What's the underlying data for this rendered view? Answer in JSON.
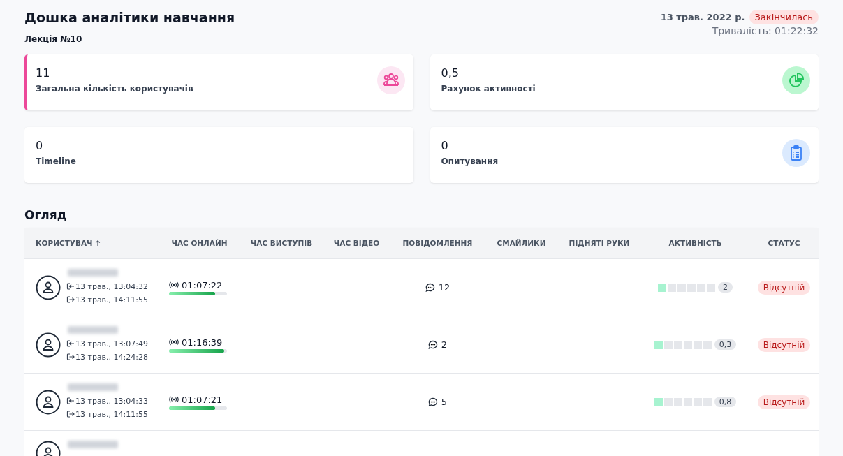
{
  "header": {
    "title": "Дошка аналітики навчання",
    "subtitle": "Лекція №10",
    "date": "13 трав. 2022 р.",
    "status": "Закінчилась",
    "duration": "Тривалість: 01:22:32"
  },
  "cards": [
    {
      "value": "11",
      "label": "Загальна кількість користувачів",
      "kind": "users",
      "accent": true
    },
    {
      "value": "0,5",
      "label": "Рахунок активності",
      "kind": "pie",
      "accent": false
    },
    {
      "value": "0",
      "label": "Timeline",
      "kind": "plain",
      "accent": false
    },
    {
      "value": "0",
      "label": "Опитування",
      "kind": "clipboard",
      "accent": false
    }
  ],
  "overview": {
    "title": "Огляд",
    "columns": [
      {
        "label": "КОРИСТУВАЧ",
        "sorted": true
      },
      {
        "label": "ЧАС ОНЛАЙН",
        "sorted": false
      },
      {
        "label": "ЧАС ВИСТУПІВ",
        "sorted": false
      },
      {
        "label": "ЧАС ВІДЕО",
        "sorted": false
      },
      {
        "label": "ПОВІДОМЛЕННЯ",
        "sorted": false
      },
      {
        "label": "СМАЙЛИКИ",
        "sorted": false
      },
      {
        "label": "ПІДНЯТІ РУКИ",
        "sorted": false
      },
      {
        "label": "АКТИВНІСТЬ",
        "sorted": false
      },
      {
        "label": "СТАТУС",
        "sorted": false
      }
    ],
    "rows": [
      {
        "cut": false,
        "joined": "13 трав., 13:04:32",
        "left": "13 трав., 14:11:55",
        "online": "01:07:22",
        "level": 0.8,
        "messages": "12",
        "stars": 1,
        "activity": "2",
        "status": "Відсутній"
      },
      {
        "cut": false,
        "joined": "13 трав., 13:07:49",
        "left": "13 трав., 14:24:28",
        "online": "01:16:39",
        "level": 0.95,
        "messages": "2",
        "stars": 1,
        "activity": "0,3",
        "status": "Відсутній"
      },
      {
        "cut": false,
        "joined": "13 трав., 13:04:33",
        "left": "13 трав., 14:11:55",
        "online": "01:07:21",
        "level": 0.8,
        "messages": "5",
        "stars": 1,
        "activity": "0,8",
        "status": "Відсутній"
      },
      {
        "cut": true
      }
    ]
  }
}
